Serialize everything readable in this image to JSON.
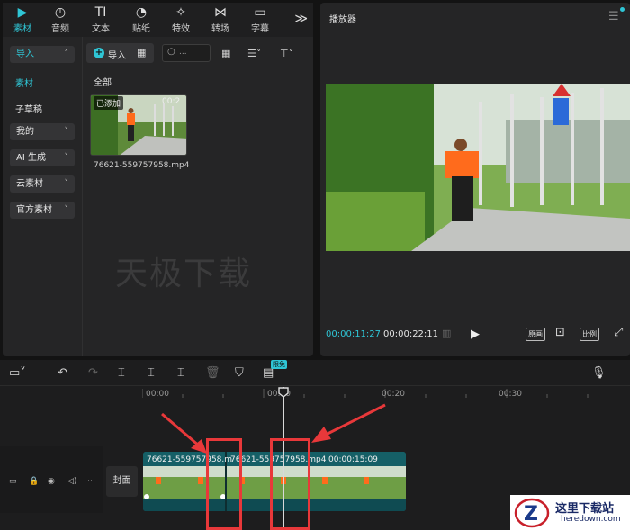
{
  "tabs": [
    {
      "label": "素材",
      "icon": "media-icon",
      "active": true
    },
    {
      "label": "音频",
      "icon": "audio-icon"
    },
    {
      "label": "文本",
      "icon": "text-icon"
    },
    {
      "label": "贴纸",
      "icon": "sticker-icon"
    },
    {
      "label": "特效",
      "icon": "effects-icon"
    },
    {
      "label": "转场",
      "icon": "transition-icon"
    },
    {
      "label": "字幕",
      "icon": "subtitle-icon"
    }
  ],
  "nav": {
    "import": "导入",
    "material": "素材",
    "sub_draft": "子草稿",
    "mine": "我的",
    "ai_gen": "AI 生成",
    "cloud": "云素材",
    "official": "官方素材"
  },
  "media": {
    "import_label": "导入",
    "search_placeholder": "...",
    "all_label": "全部",
    "clip_badge": "已添加",
    "clip_duration": "00:2",
    "clip_name": "76621-559757958.mp4"
  },
  "watermark": "天极下载",
  "player": {
    "title": "播放器",
    "current_time": "00:00:11:27",
    "total_time": "00:00:22:11",
    "original_label": "原画",
    "ratio_label": "比例"
  },
  "timeline": {
    "free_badge": "限免",
    "ticks": [
      "00:00",
      "00:10",
      "00:20",
      "00:30"
    ],
    "cover_label": "封面",
    "clip1_label": "76621-559757958.m",
    "clip2_label": "76621-559757958.mp4",
    "clip2_duration": "00:00:15:09"
  },
  "site_logo": {
    "cn": "这里下载站",
    "en": "heredown.com"
  },
  "colors": {
    "accent": "#2fc6d6",
    "highlight": "#e8383a",
    "clip": "#155f66"
  }
}
